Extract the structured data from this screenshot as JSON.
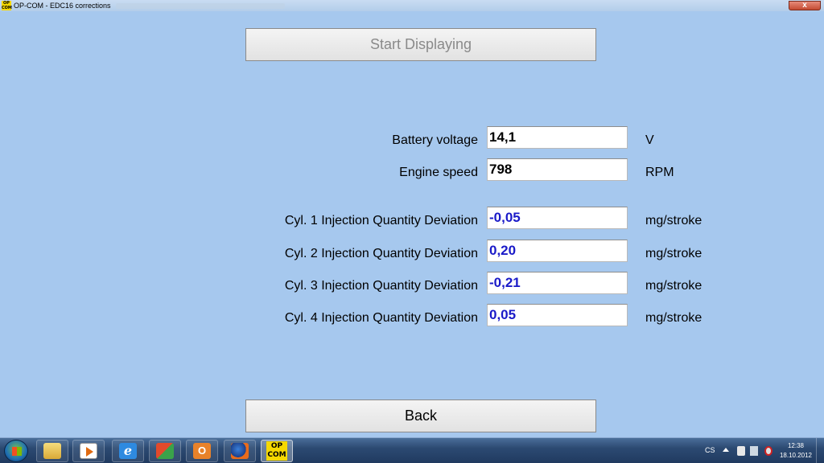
{
  "window": {
    "logo_text": "OP\nCOM",
    "title": "OP-COM - EDC16 corrections",
    "close_label": "x"
  },
  "buttons": {
    "start": "Start Displaying",
    "back": "Back"
  },
  "readings": [
    {
      "label": "Battery voltage",
      "value": "14,1",
      "unit": "V"
    },
    {
      "label": "Engine speed",
      "value": "798",
      "unit": "RPM"
    },
    {
      "label": "Cyl. 1 Injection Quantity Deviation",
      "value": "-0,05",
      "unit": "mg/stroke"
    },
    {
      "label": "Cyl. 2 Injection Quantity Deviation",
      "value": "0,20",
      "unit": "mg/stroke"
    },
    {
      "label": "Cyl. 3 Injection Quantity Deviation",
      "value": "-0,21",
      "unit": "mg/stroke"
    },
    {
      "label": "Cyl. 4 Injection Quantity Deviation",
      "value": "0,05",
      "unit": "mg/stroke"
    }
  ],
  "colors": {
    "background": "#a6c8ee",
    "deviation_value": "#1a1ac8"
  },
  "taskbar": {
    "items": [
      "folder-icon",
      "media-player-icon",
      "internet-explorer-icon",
      "remote-desktop-icon",
      "outlook-icon",
      "firefox-icon",
      "opcom-icon"
    ],
    "ie_glyph": "e",
    "outlook_glyph": "O",
    "opcom_label": "OP\nCOM",
    "language": "CS",
    "time": "12:38",
    "date": "18.10.2012"
  }
}
